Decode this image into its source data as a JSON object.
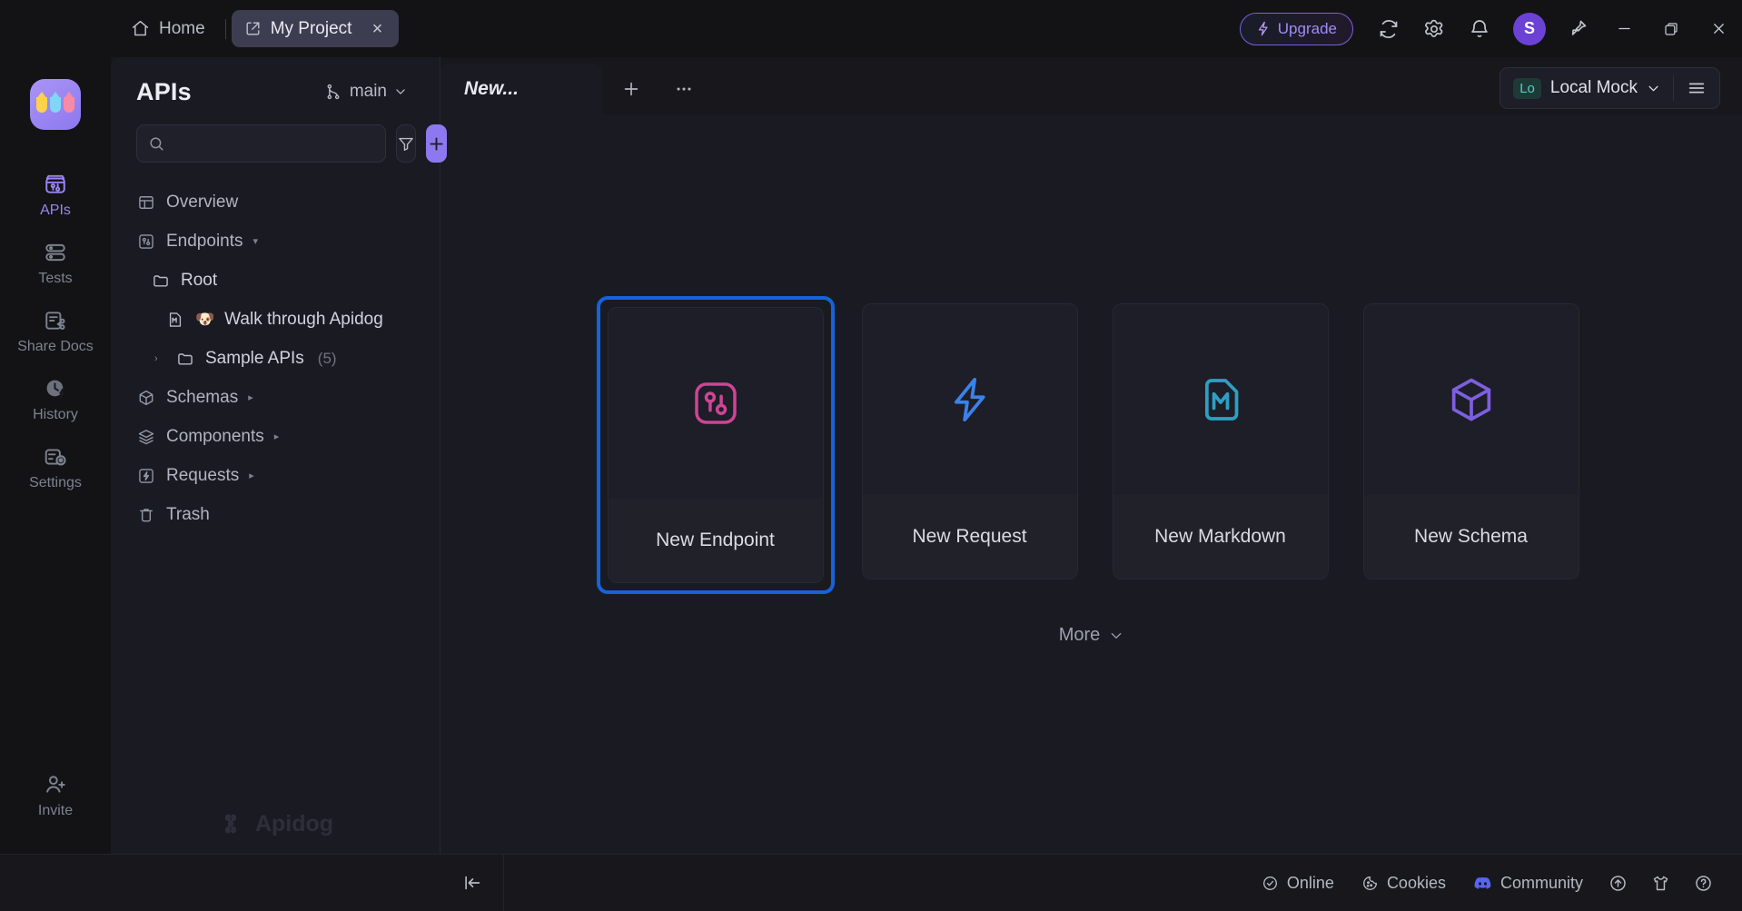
{
  "titlebar": {
    "home_tab": "Home",
    "project_tab": "My Project",
    "close_tab": "×",
    "upgrade": "Upgrade",
    "avatar_initial": "S",
    "icons": {
      "home": "home-icon",
      "project": "external-link-icon",
      "sync": "sync-icon",
      "settings": "gear-icon",
      "notifications": "bell-icon",
      "pin": "pin-icon",
      "minimize": "minimize-icon",
      "maximize": "maximize-icon",
      "close": "close-icon"
    },
    "accent_purple": "#6c42d4",
    "upgrade_border": "#7b5fe0"
  },
  "rail": {
    "logo_name": "apidog-logo",
    "items": [
      {
        "label": "APIs",
        "icon": "apis-icon",
        "active": true
      },
      {
        "label": "Tests",
        "icon": "tests-icon",
        "active": false
      },
      {
        "label": "Share Docs",
        "icon": "share-docs-icon",
        "active": false
      },
      {
        "label": "History",
        "icon": "history-icon",
        "active": false
      },
      {
        "label": "Settings",
        "icon": "settings-icon",
        "active": false
      }
    ],
    "bottom": {
      "label": "Invite",
      "icon": "invite-icon"
    },
    "active_color": "#9b85f2"
  },
  "sidebar": {
    "title": "APIs",
    "branch": "main",
    "branch_icon": "git-branch-icon",
    "search_placeholder": "",
    "search_value": "",
    "search_icon": "search-icon",
    "filter_icon": "filter-icon",
    "add_icon": "plus-icon",
    "watermark": "Apidog",
    "tree": [
      {
        "label": "Overview",
        "icon": "overview-icon",
        "level": 0,
        "caret": "",
        "count": "",
        "emoji": ""
      },
      {
        "label": "Endpoints",
        "icon": "endpoints-icon",
        "level": 0,
        "caret": "▾",
        "count": "",
        "emoji": ""
      },
      {
        "label": "Root",
        "icon": "folder-icon",
        "level": 1,
        "caret": "",
        "count": "",
        "emoji": ""
      },
      {
        "label": "Walk through Apidog",
        "icon": "markdown-file-icon",
        "level": 2,
        "caret": "",
        "count": "",
        "emoji": "🐶"
      },
      {
        "label": "Sample APIs",
        "icon": "folder-icon",
        "level": 1,
        "caret": "›",
        "count": "(5)",
        "emoji": ""
      },
      {
        "label": "Schemas",
        "icon": "schema-icon",
        "level": 0,
        "caret": "▸",
        "caret_after": true,
        "count": "",
        "emoji": ""
      },
      {
        "label": "Components",
        "icon": "components-icon",
        "level": 0,
        "caret": "▸",
        "caret_after": true,
        "count": "",
        "emoji": ""
      },
      {
        "label": "Requests",
        "icon": "requests-icon",
        "level": 0,
        "caret": "▸",
        "caret_after": true,
        "count": "",
        "emoji": ""
      },
      {
        "label": "Trash",
        "icon": "trash-icon",
        "level": 0,
        "caret": "",
        "count": "",
        "emoji": ""
      }
    ]
  },
  "main": {
    "tab_label": "New...",
    "new_tab_icon": "plus-icon",
    "tab_more_icon": "ellipsis-icon",
    "environment": {
      "badge": "Lo",
      "name": "Local Mock",
      "chevron": "chevron-down-icon",
      "menu_icon": "hamburger-icon",
      "badge_color": "#4fd1bd"
    },
    "cards": [
      {
        "label": "New Endpoint",
        "icon": "endpoint-icon",
        "color": "#cf4496",
        "selected": true
      },
      {
        "label": "New Request",
        "icon": "lightning-icon",
        "color": "#3b82e8",
        "selected": false
      },
      {
        "label": "New Markdown",
        "icon": "markdown-icon",
        "color": "#2e9fc4",
        "selected": false
      },
      {
        "label": "New Schema",
        "icon": "cube-icon",
        "color": "#7d5fe0",
        "selected": false
      }
    ],
    "more_label": "More",
    "more_chevron": "chevron-down-icon",
    "selection_ring_color": "#1463dd"
  },
  "statusbar": {
    "collapse_icon": "collapse-panel-icon",
    "items": [
      {
        "label": "Online",
        "icon": "check-circle-icon"
      },
      {
        "label": "Cookies",
        "icon": "cookie-icon"
      },
      {
        "label": "Community",
        "icon": "discord-icon"
      }
    ],
    "icon_buttons": [
      {
        "icon": "upload-circle-icon"
      },
      {
        "icon": "shirt-icon"
      },
      {
        "icon": "help-circle-icon"
      }
    ],
    "discord_color": "#5865f2"
  }
}
